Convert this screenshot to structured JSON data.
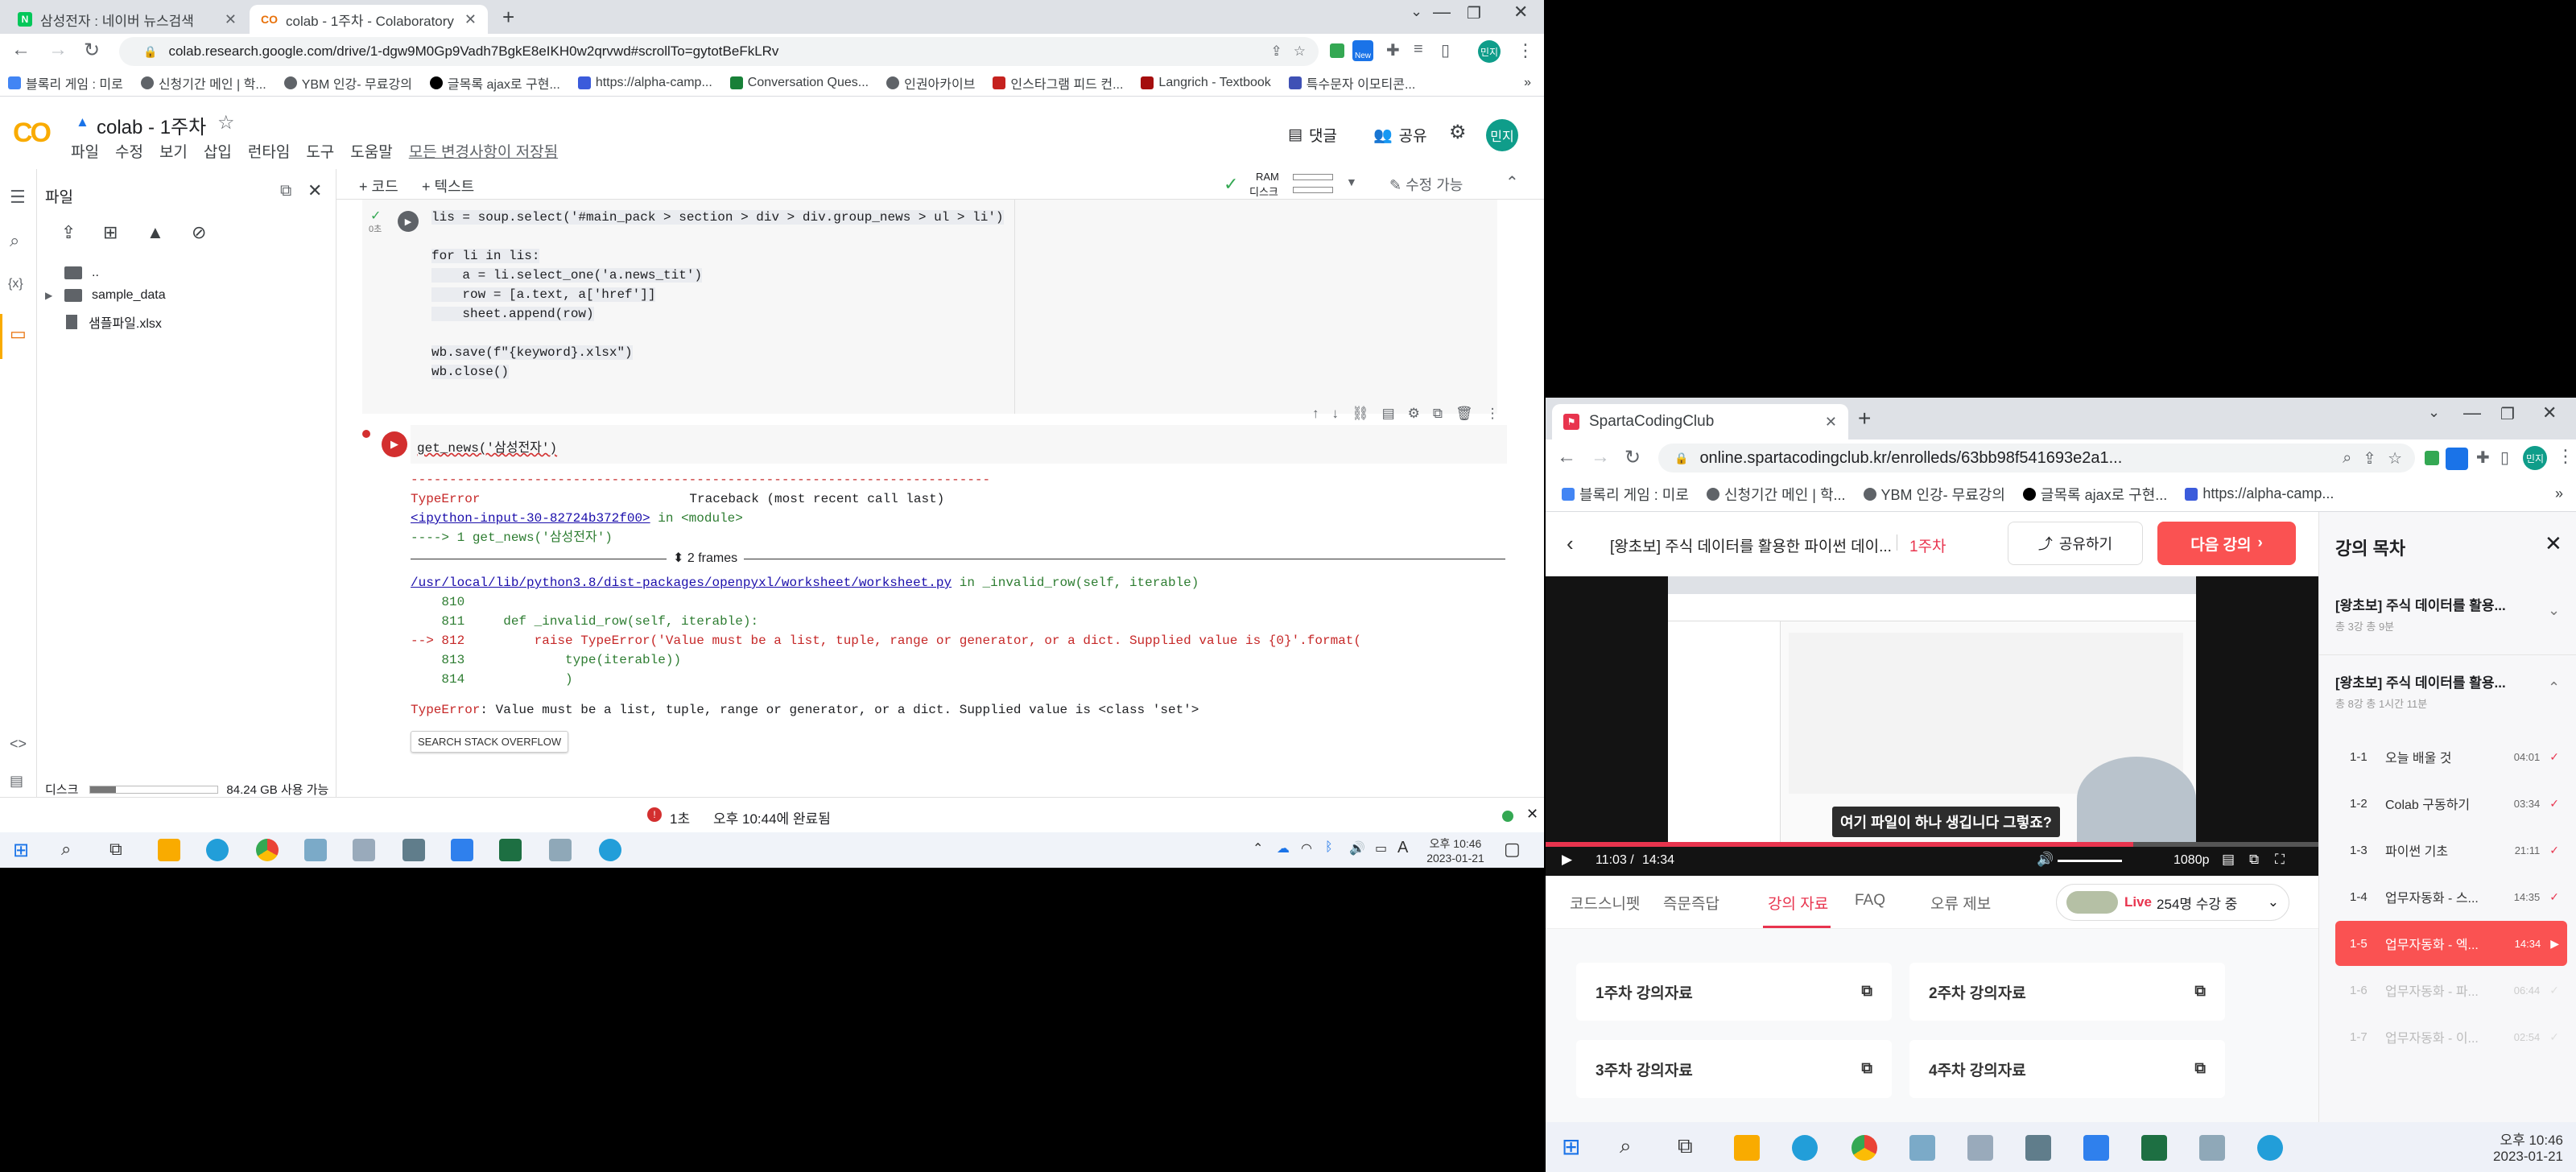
{
  "left_browser": {
    "tabs": [
      {
        "title": "삼성전자 : 네이버 뉴스검색",
        "favicon_color": "#03c75a",
        "favicon_letter": "N"
      },
      {
        "title": "colab - 1주차 - Colaboratory",
        "favicon_color": "#f9ab00",
        "favicon_letter": "CO"
      }
    ],
    "url": "colab.research.google.com/drive/1-dgw9M0Gp9Vadh7BgkE8eIKH0w2qrvwd#scrollTo=gytotBeFkLRv",
    "bookmarks": [
      "블록리 게임 : 미로",
      "신청기간 메인 | 학...",
      "YBM 인강- 무료강의",
      "글목록 ajax로 구현...",
      "https://alpha-camp...",
      "Conversation Ques...",
      "인권아카이브",
      "인스타그램 피드 컨...",
      "Langrich - Textbook",
      "특수문자 이모티콘..."
    ],
    "avatar": "민지"
  },
  "colab": {
    "logo": "CO",
    "title": "colab - 1주차",
    "menus": [
      "파일",
      "수정",
      "보기",
      "삽입",
      "런타임",
      "도구",
      "도움말"
    ],
    "saved_note": "모든 변경사항이 저장됨",
    "comment_label": "댓글",
    "share_label": "공유",
    "avatar": "민지",
    "add_code": "+ 코드",
    "add_text": "+ 텍스트",
    "ram_label": "RAM",
    "disk_label": "디스크",
    "edit_label": "수정 가능",
    "files_title": "파일",
    "files": [
      "..",
      "sample_data",
      "샘플파일.xlsx"
    ],
    "disk_status": "디스크",
    "disk_free": "84.24 GB 사용 가능",
    "cell1_exec_count": "0초",
    "cell1_lines": [
      "lis = soup.select('#main_pack > section > div > div.group_news > ul > li')",
      "",
      "for li in lis:",
      "    a = li.select_one('a.news_tit')",
      "    row = [a.text, a['href']]",
      "    sheet.append(row)",
      "",
      "wb.save(f\"{keyword}.xlsx\")",
      "wb.close()"
    ],
    "cell2_code": "get_news('삼성전자')",
    "error": {
      "rule": "---------------------------------------------------------------------------",
      "type": "TypeError",
      "traceback_label": "Traceback (most recent call last)",
      "input_link": "<ipython-input-30-82724b372f00>",
      "in_module": " in <module>",
      "arrow_line": "----> 1 get_news('삼성전자')",
      "frames_label": "2 frames",
      "path": "/usr/local/lib/python3.8/dist-packages/openpyxl/worksheet/worksheet.py",
      "in_func": " in _invalid_row(self, iterable)",
      "tb_lines": [
        "    810",
        "    811     def _invalid_row(self, iterable):",
        "--> 812         raise TypeError('Value must be a list, tuple, range or generator, or a dict. Supplied value is {0}'.format(",
        "    813             type(iterable))",
        "    814             )"
      ],
      "final_type": "TypeError",
      "final_msg": ": Value must be a list, tuple, range or generator, or a dict. Supplied value is <class 'set'>",
      "so_button": "SEARCH STACK OVERFLOW"
    },
    "status_time": "1초",
    "status_msg": "오후 10:44에 완료됨"
  },
  "taskbar_left": {
    "time": "오후 10:46",
    "date": "2023-01-21",
    "ime": "A"
  },
  "right_browser": {
    "tab_title": "SpartaCodingClub",
    "url": "online.spartacodingclub.kr/enrolleds/63bb98f541693e2a1...",
    "bookmarks": [
      "블록리 게임 : 미로",
      "신청기간 메인 | 학...",
      "YBM 인강- 무료강의",
      "글목록 ajax로 구현...",
      "https://alpha-camp..."
    ],
    "avatar": "민지"
  },
  "sparta": {
    "course_title": "[왕초보] 주식 데이터를 활용한 파이썬 데이...",
    "week": "1주차",
    "share": "공유하기",
    "next": "다음 강의",
    "video_caption": "여기 파일이 하나 생깁니다 그렇죠?",
    "time_current": "11:03 /",
    "time_total": "14:34",
    "quality": "1080p",
    "tabs": [
      "코드스니펫",
      "즉문즉답",
      "강의 자료",
      "FAQ",
      "오류 제보"
    ],
    "live_label": "Live",
    "live_count": "254명 수강 중",
    "materials": [
      "1주차 강의자료",
      "2주차 강의자료",
      "3주차 강의자료",
      "4주차 강의자료"
    ],
    "toc_title": "강의 목차",
    "toc_courses": [
      {
        "title": "[왕초보] 주식 데이터를 활용...",
        "meta": "총 3강   총 9분"
      },
      {
        "title": "[왕초보] 주식 데이터를 활용...",
        "meta": "총 8강   총 1시간 11분"
      }
    ],
    "lectures": [
      {
        "num": "1-1",
        "title": "오늘 배울 것",
        "time": "04:01"
      },
      {
        "num": "1-2",
        "title": "Colab 구동하기",
        "time": "03:34"
      },
      {
        "num": "1-3",
        "title": "파이썬 기초",
        "time": "21:11"
      },
      {
        "num": "1-4",
        "title": "업무자동화 - 스...",
        "time": "14:35"
      },
      {
        "num": "1-5",
        "title": "업무자동화 - 엑...",
        "time": "14:34"
      },
      {
        "num": "1-6",
        "title": "업무자동화 - 파...",
        "time": "06:44"
      },
      {
        "num": "1-7",
        "title": "업무자동화 - 이...",
        "time": "02:54"
      }
    ],
    "video_progress": 0.76
  },
  "taskbar_right": {
    "time": "오후 10:46",
    "date": "2023-01-21"
  },
  "colors": {
    "accent_red": "#fa5252",
    "colab_orange": "#f9ab00",
    "link_blue": "#1a73e8",
    "error_red": "#c62828"
  }
}
